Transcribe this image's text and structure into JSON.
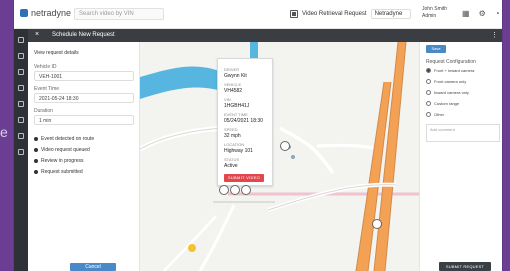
{
  "background": {
    "side_text": "e"
  },
  "app": {
    "brand": "netradyne",
    "search_placeholder": "Search video by VIN"
  },
  "topbar": {
    "workspace_label": "Video Retrieval Request",
    "workspace_value": "Netradyne",
    "user_name": "John Smith",
    "user_role": "Admin",
    "icons": [
      "grid-icon",
      "settings-icon",
      "bell-icon",
      "user-icon"
    ]
  },
  "page": {
    "title": "Schedule New Request",
    "close_glyph": "×"
  },
  "left_panel": {
    "view_label": "View request details",
    "vehicle_label": "Vehicle ID",
    "vehicle_value": "VEH-1001",
    "time_label": "Event Time",
    "time_value": "2021-05-24 18:30",
    "duration_label": "Duration",
    "duration_value": "1 min",
    "list": [
      "Event detected on route",
      "Video request queued",
      "Review in progress",
      "Request submitted"
    ],
    "cancel_label": "Cancel"
  },
  "popup": {
    "rows": [
      {
        "k": "DRIVER",
        "v": "Gwynn Kit"
      },
      {
        "k": "VEHICLE",
        "v": "VH4582"
      },
      {
        "k": "VIN",
        "v": "1HGBH41J"
      },
      {
        "k": "EVENT TIME",
        "v": "05/24/2021 18:30"
      },
      {
        "k": "SPEED",
        "v": "32 mph"
      },
      {
        "k": "LOCATION",
        "v": "Highway 101"
      },
      {
        "k": "STATUS",
        "v": "Active"
      }
    ],
    "button_label": "SUBMIT VIDEO REQ"
  },
  "right_panel": {
    "button_label": "Save",
    "section_title": "Request Configuration",
    "options": [
      {
        "label": "Front + Inward camera",
        "checked": true
      },
      {
        "label": "Front camera only",
        "checked": false
      },
      {
        "label": "Inward camera only",
        "checked": false
      },
      {
        "label": "Custom range",
        "checked": false
      },
      {
        "label": "Other",
        "checked": false
      }
    ],
    "comment_placeholder": "Add comment",
    "submit_label": "SUBMIT REQUEST"
  }
}
